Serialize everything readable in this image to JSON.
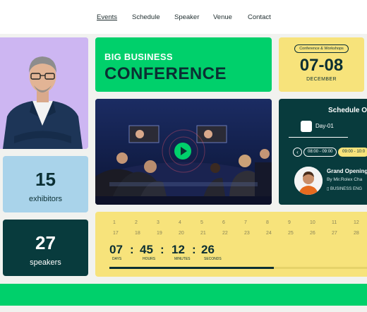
{
  "nav": {
    "items": [
      "Events",
      "Schedule",
      "Speaker",
      "Venue",
      "Contact"
    ],
    "active": "Events"
  },
  "hero": {
    "line1": "BIG BUSINESS",
    "line2": "CONFERENCE"
  },
  "date_card": {
    "badge": "Conference & Workshops",
    "days": "07-08",
    "month": "DECEMBER"
  },
  "stats": {
    "exhibitors_value": "15",
    "exhibitors_label": "exhibitors",
    "speakers_value": "27",
    "speakers_label": "speakers"
  },
  "schedule": {
    "title": "Schedule O",
    "day": "Day-01",
    "prev_icon": "chevron-left-icon",
    "slots": [
      "08:00 - 09:00",
      "09:00 - 10:0"
    ],
    "event_title": "Grand Opening",
    "event_by": "By Mir.Rolex Cha",
    "event_tags": "BUSINESS  ENG"
  },
  "countdown": {
    "dates_row1": [
      "1",
      "2",
      "3",
      "4",
      "5",
      "6",
      "7",
      "8",
      "9",
      "10",
      "11",
      "12"
    ],
    "dates_row2": [
      "17",
      "18",
      "19",
      "20",
      "21",
      "22",
      "23",
      "24",
      "25",
      "26",
      "27",
      "28"
    ],
    "values": [
      {
        "value": "07",
        "label": "DAYS"
      },
      {
        "value": "45",
        "label": "HOURS"
      },
      {
        "value": "12",
        "label": "MINUTES"
      },
      {
        "value": "26",
        "label": "SECONDS"
      }
    ],
    "progress": 0.63
  },
  "colors": {
    "green": "#00d06b",
    "teal": "#083b3d",
    "yellow": "#f7e37b",
    "lilac": "#cdb6f2",
    "sky": "#a9d3ea"
  }
}
